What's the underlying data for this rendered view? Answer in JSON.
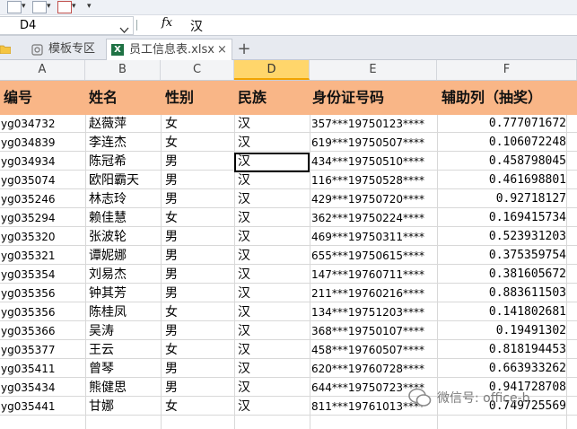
{
  "formula_bar": {
    "name_box": "D4",
    "fx_label": "fx",
    "value": "汉"
  },
  "tabs": [
    {
      "label": "模板专区"
    },
    {
      "label": "员工信息表.xlsx",
      "close": "×"
    },
    {
      "label": "+"
    }
  ],
  "columns": [
    "A",
    "B",
    "C",
    "D",
    "E",
    "F"
  ],
  "selected_column": "D",
  "table": {
    "headers": [
      "编号",
      "姓名",
      "性别",
      "民族",
      "身份证号码",
      "辅助列（抽奖）"
    ],
    "rows": [
      [
        "yg034732",
        "赵薇萍",
        "女",
        "汉",
        "357***19750123****",
        "0.777071672"
      ],
      [
        "yg034839",
        "李连杰",
        "女",
        "汉",
        "619***19750507****",
        "0.106072248"
      ],
      [
        "yg034934",
        "陈冠希",
        "男",
        "汉",
        "434***19750510****",
        "0.458798045"
      ],
      [
        "yg035074",
        "欧阳霸天",
        "男",
        "汉",
        "116***19750528****",
        "0.461698801"
      ],
      [
        "yg035246",
        "林志玲",
        "男",
        "汉",
        "429***19750720****",
        "0.92718127"
      ],
      [
        "yg035294",
        "赖佳慧",
        "女",
        "汉",
        "362***19750224****",
        "0.169415734"
      ],
      [
        "yg035320",
        "张波轮",
        "男",
        "汉",
        "469***19750311****",
        "0.523931203"
      ],
      [
        "yg035321",
        "谭妮娜",
        "男",
        "汉",
        "655***19750615****",
        "0.375359754"
      ],
      [
        "yg035354",
        "刘易杰",
        "男",
        "汉",
        "147***19760711****",
        "0.381605672"
      ],
      [
        "yg035356",
        "钟其芳",
        "男",
        "汉",
        "211***19760216****",
        "0.883611503"
      ],
      [
        "yg035356",
        "陈桂凤",
        "女",
        "汉",
        "134***19751203****",
        "0.141802681"
      ],
      [
        "yg035366",
        "吴涛",
        "男",
        "汉",
        "368***19750107****",
        "0.19491302"
      ],
      [
        "yg035377",
        "王云",
        "女",
        "汉",
        "458***19760507****",
        "0.818194453"
      ],
      [
        "yg035411",
        "曾琴",
        "男",
        "汉",
        "620***19760728****",
        "0.663933262"
      ],
      [
        "yg035434",
        "熊健思",
        "男",
        "汉",
        "644***19750723****",
        "0.941728708"
      ],
      [
        "yg035441",
        "甘娜",
        "女",
        "汉",
        "811***19761013****",
        "0.749725569"
      ]
    ]
  },
  "watermark": "微信号: office-b"
}
